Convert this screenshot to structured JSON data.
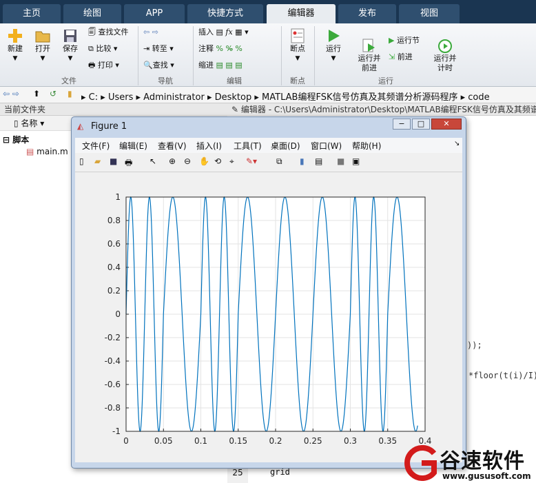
{
  "ribbon_tabs": [
    "主页",
    "绘图",
    "APP",
    "快捷方式",
    "编辑器",
    "发布",
    "视图"
  ],
  "ribbon": {
    "file": {
      "new": "新建",
      "open": "打开",
      "save": "保存",
      "find_files": "查找文件",
      "compare": "比较",
      "print": "打印",
      "group": "文件"
    },
    "nav": {
      "goto": "转至",
      "find": "查找",
      "group": "导航"
    },
    "edit": {
      "insert": "插入",
      "comment": "注释",
      "indent": "缩进",
      "fx": "fx",
      "group": "编辑"
    },
    "breakpoints": {
      "label": "断点",
      "group": "断点"
    },
    "run": {
      "run": "运行",
      "run_advance": "运行并\n前进",
      "run_section": "运行节",
      "advance": "前进",
      "run_time": "运行并\n计时",
      "group": "运行"
    }
  },
  "address": {
    "path": [
      "C:",
      "Users",
      "Administrator",
      "Desktop",
      "MATLAB编程FSK信号仿真及其频谱分析源码程序",
      "code"
    ]
  },
  "left_panel": {
    "title": "当前文件夹",
    "col_name": "名称 ▾",
    "section": "脚本",
    "file": "main.m"
  },
  "editor": {
    "title": "编辑器 - C:\\Users\\Administrator\\Desktop\\MATLAB编程FSK信号仿真及其频谱分",
    "line_num": "25",
    "line_code": "grid",
    "code_frag1": "));",
    "code_frag2": "*floor(t(i)/I)"
  },
  "figure": {
    "title": "Figure 1",
    "menu": [
      "文件(F)",
      "编辑(E)",
      "查看(V)",
      "插入(I)",
      "工具(T)",
      "桌面(D)",
      "窗口(W)",
      "帮助(H)"
    ],
    "controls": [
      "−",
      "□",
      "✕"
    ]
  },
  "chart_data": {
    "type": "line",
    "title": "",
    "xlabel": "",
    "ylabel": "",
    "xlim": [
      0,
      0.4
    ],
    "ylim": [
      -1,
      1
    ],
    "xticks": [
      "0",
      "0.05",
      "0.1",
      "0.15",
      "0.2",
      "0.25",
      "0.3",
      "0.35",
      "0.4"
    ],
    "yticks": [
      "1",
      "0.8",
      "0.6",
      "0.4",
      "0.2",
      "0",
      "-0.2",
      "-0.4",
      "-0.6",
      "-0.8",
      "-1"
    ],
    "grid": true,
    "color": "#0072bd",
    "series": [
      {
        "segments": [
          {
            "t0": 0,
            "t1": 0.05,
            "f": 40,
            "phase": 0
          },
          {
            "t0": 0.05,
            "t1": 0.1,
            "f": 20,
            "phase": 0
          },
          {
            "t0": 0.1,
            "t1": 0.15,
            "f": 40,
            "phase": 0
          },
          {
            "t0": 0.15,
            "t1": 0.2,
            "f": 20,
            "phase": 0
          },
          {
            "t0": 0.2,
            "t1": 0.25,
            "f": 20,
            "phase": 0
          },
          {
            "t0": 0.25,
            "t1": 0.3,
            "f": 20,
            "phase": 0
          },
          {
            "t0": 0.3,
            "t1": 0.35,
            "f": 40,
            "phase": 0
          },
          {
            "t0": 0.35,
            "t1": 0.39,
            "f": 20,
            "phase": 0
          }
        ]
      }
    ]
  },
  "watermark": {
    "brand": "谷速软件",
    "url": "www.gususoft.com"
  }
}
